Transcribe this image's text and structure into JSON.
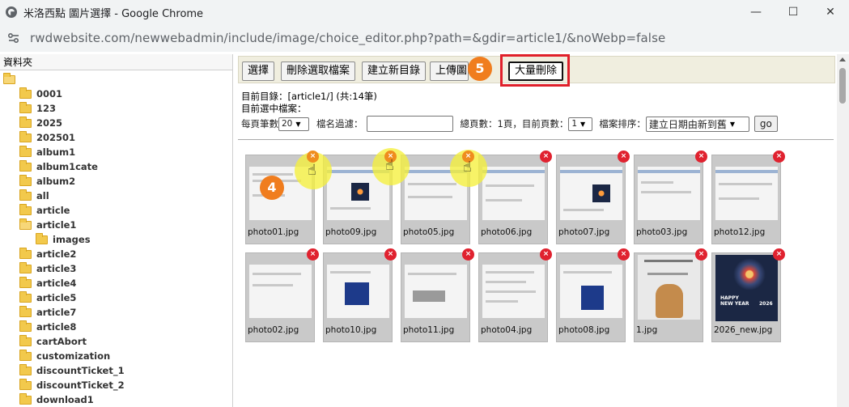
{
  "window": {
    "title": "米洛西點 圖片選擇 - Google Chrome",
    "url": "rwdwebsite.com/newwebadmin/include/image/choice_editor.php?path=&gdir=article1/&noWebp=false"
  },
  "folder_panel": {
    "header": "資料夾",
    "folders": [
      "0001",
      "123",
      "2025",
      "202501",
      "album1",
      "album1cate",
      "album2",
      "all",
      "article",
      "article1",
      "images",
      "article2",
      "article3",
      "article4",
      "article5",
      "article7",
      "article8",
      "cartAbort",
      "customization",
      "discountTicket_1",
      "discountTicket_2",
      "download1"
    ]
  },
  "toolbar": {
    "select": "選擇",
    "delete_selected": "刪除選取檔案",
    "new_dir": "建立新目錄",
    "upload": "上傳圖",
    "bulk_delete": "大量刪除"
  },
  "info": {
    "current_dir": "目前目錄：[article1/] (共:14筆)",
    "selected_file": "目前選中檔案："
  },
  "controls": {
    "per_page_label": "每頁筆數",
    "per_page_value": "20",
    "filter_label": "檔名過濾：",
    "pages_label": "總頁數：1頁，目前頁數：",
    "page_value": "1",
    "sort_label": "檔案排序：",
    "sort_value": "建立日期由新到舊",
    "go": "go"
  },
  "photos": [
    "photo01.jpg",
    "photo09.jpg",
    "photo05.jpg",
    "photo06.jpg",
    "photo07.jpg",
    "photo03.jpg",
    "photo12.jpg",
    "photo02.jpg",
    "photo10.jpg",
    "photo11.jpg",
    "photo04.jpg",
    "photo08.jpg",
    "1.jpg",
    "2026_new.jpg"
  ],
  "delete_symbol": "×",
  "badges": {
    "step4": "4",
    "step5": "5"
  },
  "icons": {
    "window_minimize": "—",
    "window_maximize": "☐",
    "window_close": "✕",
    "hand_pointer": "☝"
  },
  "thumb_text": {
    "new_year_line1": "HAPPY",
    "new_year_line2": "NEW YEAR",
    "new_year_num": "2026"
  },
  "colors": {
    "delete_red": "#e0222f",
    "highlight_orange": "#ef8d1e",
    "box_red": "#e0202a",
    "badge_orange": "#f07d1e"
  }
}
